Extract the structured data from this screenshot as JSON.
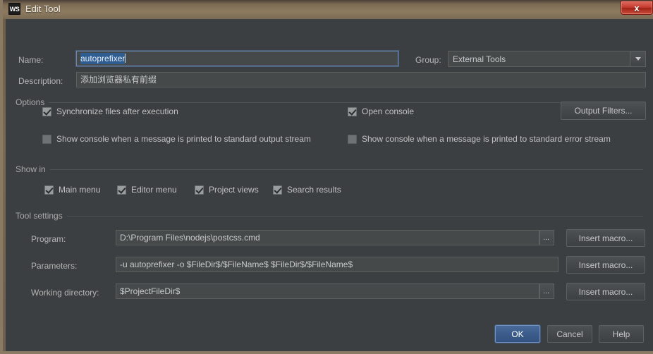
{
  "window": {
    "title": "Edit Tool",
    "app_icon_label": "WS",
    "close_label": "x",
    "accent_close": "#c43a2c",
    "bg": "#3c3f41",
    "default_button_accent": "#3c5c8c"
  },
  "form": {
    "name_label": "Name:",
    "name_value": "autoprefixer",
    "description_label": "Description:",
    "description_value": "添加浏览器私有前缀",
    "group_label": "Group:",
    "group_value": "External Tools"
  },
  "options": {
    "section_label": "Options",
    "sync_files_label": "Synchronize files after execution",
    "sync_files_checked": true,
    "open_console_label": "Open console",
    "open_console_checked": true,
    "output_filters_label": "Output Filters...",
    "stdout_label": "Show console when a message is printed to standard output stream",
    "stdout_checked": false,
    "stderr_label": "Show console when a message is printed to standard error stream",
    "stderr_checked": false
  },
  "show_in": {
    "section_label": "Show in",
    "items": [
      {
        "label": "Main menu",
        "checked": true
      },
      {
        "label": "Editor menu",
        "checked": true
      },
      {
        "label": "Project views",
        "checked": true
      },
      {
        "label": "Search results",
        "checked": true
      }
    ]
  },
  "tool_settings": {
    "section_label": "Tool settings",
    "program_label": "Program:",
    "program_value": "D:\\Program Files\\nodejs\\postcss.cmd",
    "parameters_label": "Parameters:",
    "parameters_value": "-u autoprefixer -o $FileDir$/$FileName$  $FileDir$/$FileName$",
    "working_dir_label": "Working directory:",
    "working_dir_value": "$ProjectFileDir$",
    "browse_label": "...",
    "insert_macro_label": "Insert macro..."
  },
  "footer": {
    "ok_label": "OK",
    "cancel_label": "Cancel",
    "help_label": "Help"
  }
}
